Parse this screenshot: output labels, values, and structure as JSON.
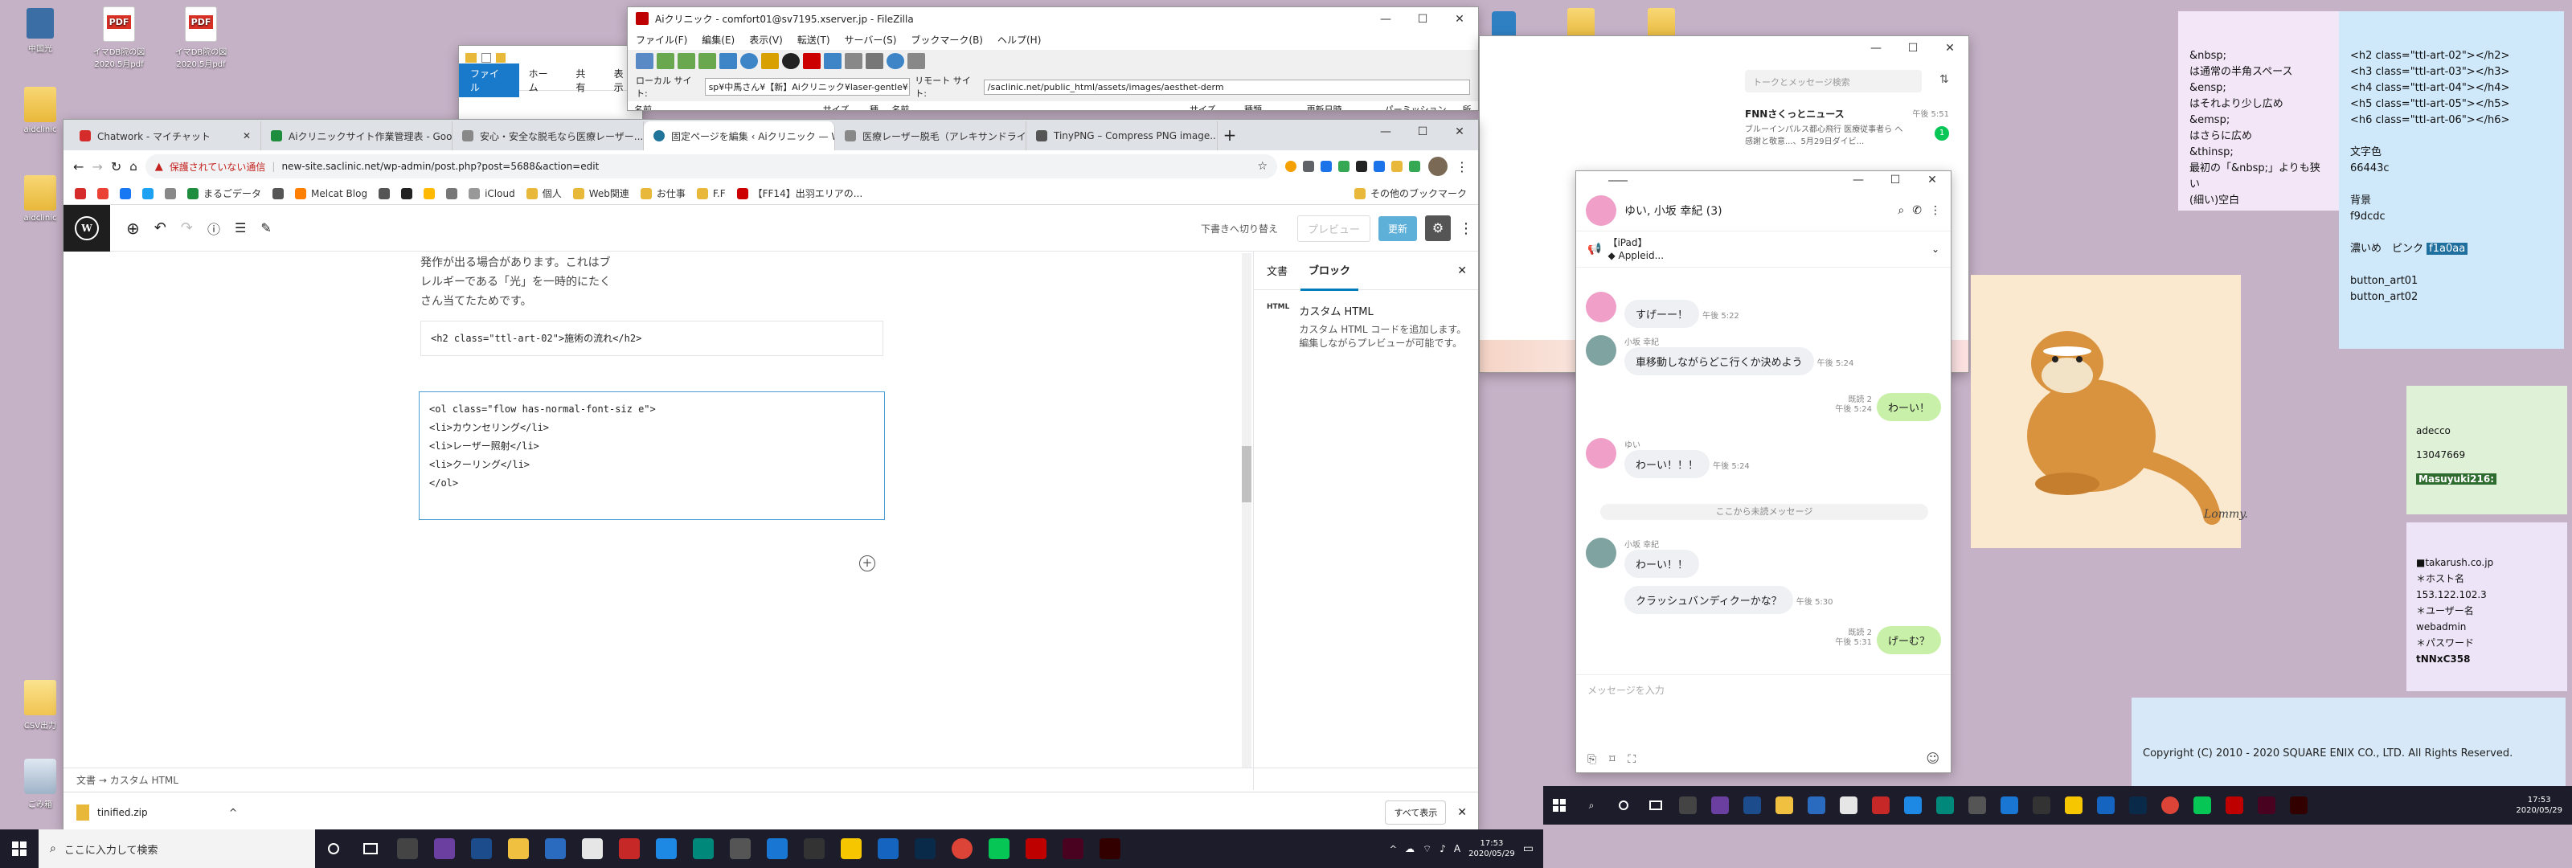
{
  "desktop": {
    "icons": [
      {
        "label": "中国光",
        "type": "app"
      },
      {
        "label": "イマDB院の図\n2020.5月pdf",
        "type": "pdf"
      },
      {
        "label": "イマDB院の図\n2020.5月pdf",
        "type": "pdf"
      },
      {
        "label": "aidclinic",
        "type": "folder"
      },
      {
        "label": "aidclinic",
        "type": "folder"
      },
      {
        "label": "CSV出力",
        "type": "file"
      },
      {
        "label": "ごみ箱",
        "type": "bin"
      }
    ]
  },
  "filezilla": {
    "title": "Aiクリニック - comfort01@sv7195.xserver.jp - FileZilla",
    "menu": [
      "ファイル(F)",
      "編集(E)",
      "表示(V)",
      "転送(T)",
      "サーバー(S)",
      "ブックマーク(B)",
      "ヘルプ(H)"
    ],
    "local_label": "ローカル サイト:",
    "local_path": "sp¥中馬さん¥【新】Aiクリニック¥laser-gentle¥",
    "remote_label": "リモート サイト:",
    "remote_path": "/saclinic.net/public_html/assets/images/aesthet-derm",
    "local_cols": [
      "名前",
      "サイズ",
      "種"
    ],
    "remote_cols": [
      "名前",
      "サイズ",
      "種類",
      "更新日時",
      "パーミッション",
      "所"
    ]
  },
  "explorer": {
    "ribbon": [
      "ファイル",
      "ホーム",
      "共有",
      "表示"
    ]
  },
  "chrome": {
    "tabs": [
      {
        "label": "Chatwork - マイチャット",
        "color": "#d62b2b"
      },
      {
        "label": "Aiクリニックサイト作業管理表 - Goo...",
        "color": "#1e8e3e"
      },
      {
        "label": "安心・安全な脱毛なら医療レーザー...",
        "color": "#888888"
      },
      {
        "label": "固定ページを編集 ‹ Aiクリニック — W...",
        "color": "#21759b"
      },
      {
        "label": "医療レーザー脱毛（アレキサンドライ...",
        "color": "#888888"
      },
      {
        "label": "TinyPNG – Compress PNG image...",
        "color": "#555555"
      }
    ],
    "security": "保護されていない通信",
    "url": "new-site.saclinic.net/wp-admin/post.php?post=5688&action=edit",
    "bookmarks": [
      "まるごデータ",
      "Melcat Blog",
      "iCloud",
      "個人",
      "Web関連",
      "お仕事",
      "F.F",
      "【FF14】出羽エリアの..."
    ],
    "bookmarks_more": "その他のブックマーク",
    "download": {
      "file": "tinified.zip",
      "show_all": "すべて表示"
    }
  },
  "wordpress": {
    "draft_switch": "下書きへ切り替え",
    "preview": "プレビュー",
    "update": "更新",
    "content_text": [
      "発作が出る場合があります。これはブ",
      "レルギーである「光」を一時的にたく",
      "さん当てたためです。"
    ],
    "h2_code": "<h2 class=\"ttl-art-02\">施術の流れ</h2>",
    "ol_code": [
      "<ol class=\"flow has-normal-font-siz e\">",
      "<li>カウンセリング</li>",
      "<li>レーザー照射</li>",
      "<li>クーリング</li>",
      "</ol>"
    ],
    "sidebar_tabs": [
      "文書",
      "ブロック"
    ],
    "block_name": "カスタム HTML",
    "block_desc": "カスタム HTML コードを追加します。編集しながらプレビューが可能です。",
    "breadcrumb": "文書 → カスタム HTML"
  },
  "line_main": {
    "search_placeholder": "トークとメッセージ検索",
    "news_title": "FNNさくっとニュース",
    "news_time": "午後 5:51",
    "news_body": "ブルーインパルス都心飛行 医療従事者ら へ感謝と敬意...、5月29日ダイビ...",
    "badge": "1"
  },
  "line_chat": {
    "title": "ゆい, 小坂 幸紀 (3)",
    "notice_title": "【iPad】",
    "notice_sub": "◆ Appleid...",
    "messages": [
      {
        "side": "left",
        "name": "",
        "text": "すげーー！",
        "time": "午後 5:22"
      },
      {
        "side": "left",
        "name": "小坂 幸紀",
        "text": "車移動しながらどこ行くか決めよう",
        "time": "午後 5:24"
      },
      {
        "side": "right",
        "read": "既読 2",
        "text": "わーい！",
        "time": "午後 5:24"
      },
      {
        "side": "left",
        "name": "ゆい",
        "text": "わーい！！！",
        "time": "午後 5:24"
      },
      {
        "side": "left",
        "name": "小坂 幸紀",
        "text": "わーい！！",
        "time": ""
      },
      {
        "side": "left",
        "name": "",
        "text": "クラッシュバンディクーかな？",
        "time": "午後 5:30"
      },
      {
        "side": "right",
        "read": "既読 2",
        "text": "げーむ？",
        "time": "午後 5:31"
      }
    ],
    "unread_divider": "ここから未読メッセージ",
    "input_placeholder": "メッセージを入力"
  },
  "notes": {
    "purple": [
      "&nbsp;",
      "は通常の半角スペース",
      "&ensp;",
      "はそれより少し広め",
      "&emsp;",
      "はさらに広め",
      "&thinsp;",
      "最初の「&nbsp;」よりも狭い",
      "(細い)空白"
    ],
    "blue": [
      "<h2 class=\"ttl-art-02\"></h2>",
      "<h3 class=\"ttl-art-03\"></h3>",
      "<h4 class=\"ttl-art-04\"></h4>",
      "<h5 class=\"ttl-art-05\"></h5>",
      "<h6 class=\"ttl-art-06\"></h6>",
      "",
      "文字色",
      "66443c",
      "",
      "背景",
      "f9dcdc",
      "",
      "濃いめ　ピンク",
      "",
      "button_art01",
      "button_art02"
    ],
    "blue_highlight": "f1a0aa",
    "green": [
      "adecco",
      "13047669"
    ],
    "green_highlight": "Masuyuki216:",
    "lavender": [
      "■takarush.co.jp",
      "＊ホスト名",
      "153.122.102.3",
      "＊ユーザー名",
      "webadmin",
      "＊パスワード"
    ],
    "lavender_bold": "tNNxC358"
  },
  "copyright": "Copyright (C) 2010 - 2020 SQUARE ENIX CO., LTD. All Rights Reserved.",
  "otter_signature": "Lommy.",
  "taskbar": {
    "search_placeholder": "ここに入力して検索",
    "time": "17:53",
    "date": "2020/05/29",
    "ime": "A"
  }
}
